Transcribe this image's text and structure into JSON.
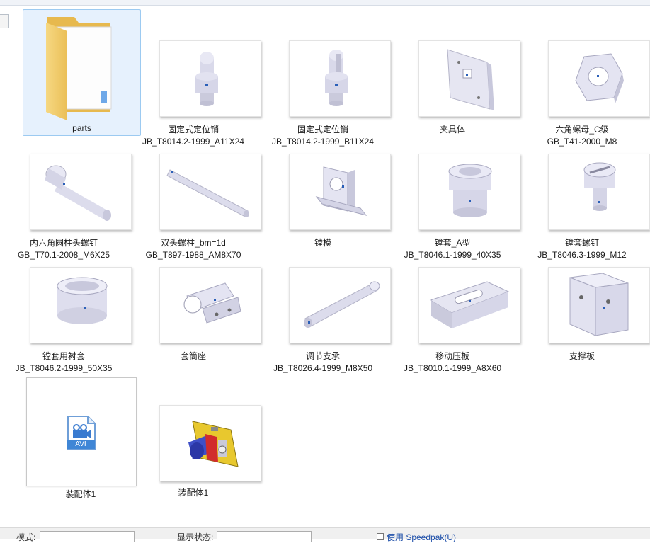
{
  "folder": {
    "name": "parts"
  },
  "items": [
    {
      "line1": "固定式定位销",
      "line2": "JB_T8014.2-1999_A11X24",
      "icon": "locating-pin-a-icon"
    },
    {
      "line1": "固定式定位销",
      "line2": "JB_T8014.2-1999_B11X24",
      "icon": "locating-pin-b-icon"
    },
    {
      "line1": "夹具体",
      "line2": "",
      "icon": "fixture-body-icon"
    },
    {
      "line1": "六角螺母_C级",
      "line2": "GB_T41-2000_M8",
      "icon": "hex-nut-icon"
    },
    {
      "line1": "内六角圆柱头螺钉",
      "line2": "GB_T70.1-2008_M6X25",
      "icon": "socket-head-screw-icon"
    },
    {
      "line1": "双头螺柱_bm=1d",
      "line2": "GB_T897-1988_AM8X70",
      "icon": "double-end-stud-icon"
    },
    {
      "line1": "镗模",
      "line2": "",
      "icon": "boring-jig-icon"
    },
    {
      "line1": "镗套_A型",
      "line2": "JB_T8046.1-1999_40X35",
      "icon": "boring-bushing-a-icon"
    },
    {
      "line1": "镗套螺钉",
      "line2": "JB_T8046.3-1999_M12",
      "icon": "bushing-screw-icon"
    },
    {
      "line1": "镗套用衬套",
      "line2": "JB_T8046.2-1999_50X35",
      "icon": "liner-bushing-icon"
    },
    {
      "line1": "套筒座",
      "line2": "",
      "icon": "sleeve-seat-icon"
    },
    {
      "line1": "调节支承",
      "line2": "JB_T8026.4-1999_M8X50",
      "icon": "adjustable-support-icon"
    },
    {
      "line1": "移动压板",
      "line2": "JB_T8010.1-1999_A8X60",
      "icon": "moving-clamp-plate-icon"
    },
    {
      "line1": "支撑板",
      "line2": "",
      "icon": "support-plate-icon"
    }
  ],
  "avi_file": {
    "name": "装配体1",
    "badge": "AVI"
  },
  "assembly_file": {
    "name": "装配体1"
  },
  "status_bar": {
    "mode_label": "模式:",
    "display_state_label": "显示状态:",
    "speedpak_label": "使用 Speedpak(U)"
  }
}
